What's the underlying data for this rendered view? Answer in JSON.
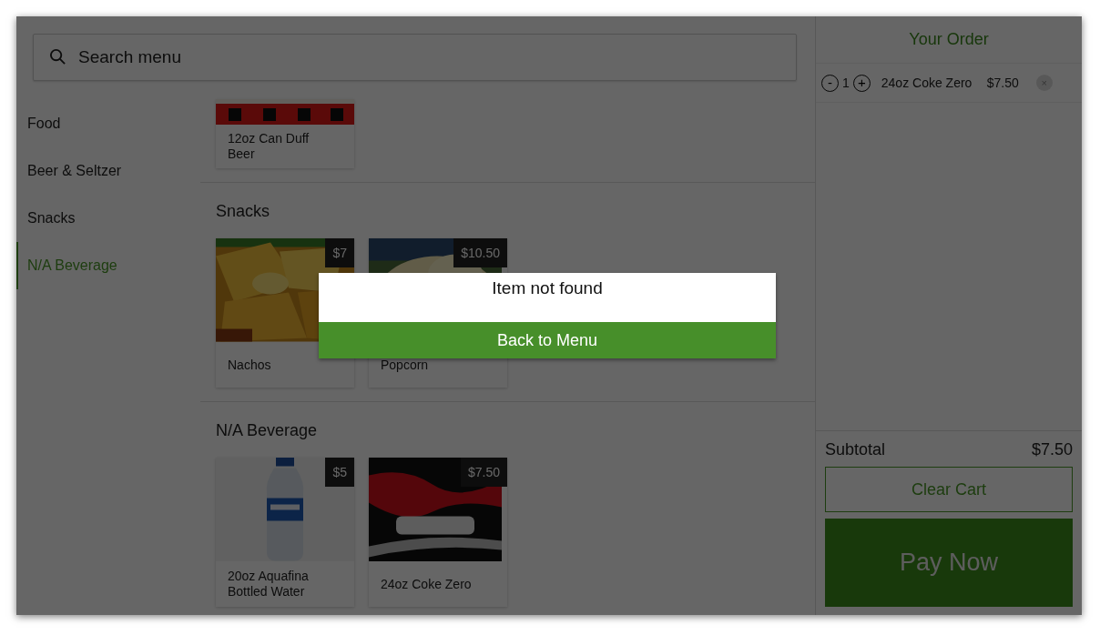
{
  "search": {
    "placeholder": "Search menu"
  },
  "categories": [
    {
      "label": "Food",
      "selected": false
    },
    {
      "label": "Beer & Seltzer",
      "selected": false
    },
    {
      "label": "Snacks",
      "selected": false
    },
    {
      "label": "N/A Beverage",
      "selected": true
    }
  ],
  "sections": [
    {
      "products": [
        {
          "name": "12oz Can Duff Beer",
          "kind": "picture"
        }
      ]
    },
    {
      "title": "Snacks",
      "products": [
        {
          "name": "Nachos",
          "price": "$7",
          "kind": "picture"
        },
        {
          "name": "Popcorn",
          "price": "$10.50",
          "kind": "picture"
        }
      ]
    },
    {
      "title": "N/A Beverage",
      "products": [
        {
          "name": "20oz Aquafina Bottled Water",
          "price": "$5",
          "kind": "picture"
        },
        {
          "name": "24oz Coke Zero",
          "price": "$7.50",
          "kind": "picture"
        }
      ]
    }
  ],
  "order": {
    "title": "Your Order",
    "items": [
      {
        "minus": "-",
        "quantity": "1",
        "plus": "+",
        "name": "24oz Coke Zero",
        "price": "$7.50",
        "remove": "×"
      }
    ],
    "subtotal_label": "Subtotal",
    "subtotal": "$7.50",
    "clear_button": "Clear Cart",
    "pay_button": "Pay Now"
  },
  "dialog": {
    "message": "Item not found",
    "button": "Back to Menu"
  }
}
